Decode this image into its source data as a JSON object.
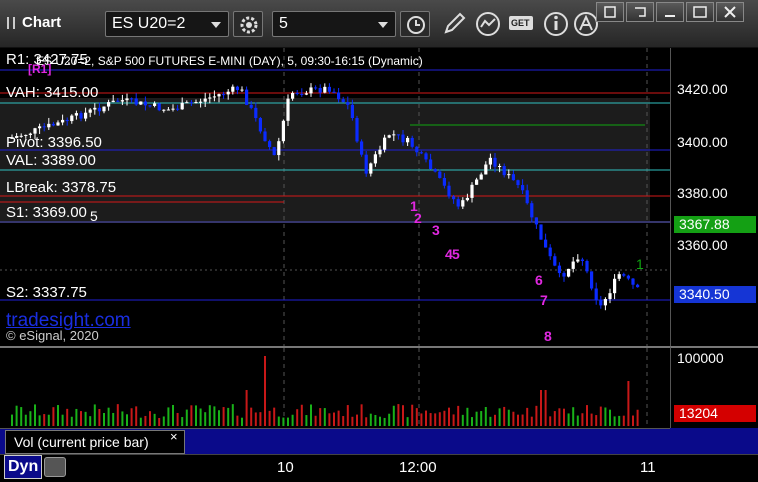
{
  "window": {
    "title": "Chart"
  },
  "toolbar": {
    "symbol": "ES U20=2",
    "interval": "5",
    "get_label": "GET"
  },
  "chart": {
    "title": "ES U20=2, S&P 500 FUTURES E-MINI (DAY), 5, 09:30-16:15 (Dynamic)",
    "brand": "tradesight.com",
    "copyright": "© eSignal, 2020",
    "overlap_label": "[R1]",
    "colors": {
      "up_candle": "#ffffff",
      "down_candle": "#0b2bff",
      "level_blue": "#1f1fd6",
      "level_cyan": "#2fbfbf",
      "level_red": "#d41818",
      "level_green": "#0fa60f",
      "wave_magenta": "#e028e0",
      "volume_up": "#19b219",
      "volume_down": "#c81818",
      "last_price_tag": "#14a014",
      "current_tag": "#1535d5",
      "volume_tag": "#d40000"
    },
    "levels": {
      "r1": "R1: 3427.75",
      "vah": "VAH: 3415.00",
      "pivot": "Pivot: 3396.50",
      "val": "VAL: 3389.00",
      "lbreak": "LBreak: 3378.75",
      "s1": "S1: 3369.00",
      "s2": "S2: 3337.75"
    },
    "wave_labels": [
      "1",
      "2",
      "3",
      "4",
      "5",
      "6",
      "7",
      "8"
    ],
    "wave_side_labels": [
      "5",
      "1"
    ]
  },
  "price_axis": {
    "ticks": [
      "3420.00",
      "3400.00",
      "3380.00",
      "3360.00"
    ],
    "last_price_tag": "3367.88",
    "current_tag": "3340.50"
  },
  "volume": {
    "legend": "Vol (current price bar)",
    "close_label": "×",
    "axis_tick": "100000",
    "current_tag": "13204"
  },
  "time_axis": {
    "labels": [
      "10",
      "12:00",
      "11"
    ]
  },
  "bottom": {
    "dyn_label": "Dyn"
  }
}
